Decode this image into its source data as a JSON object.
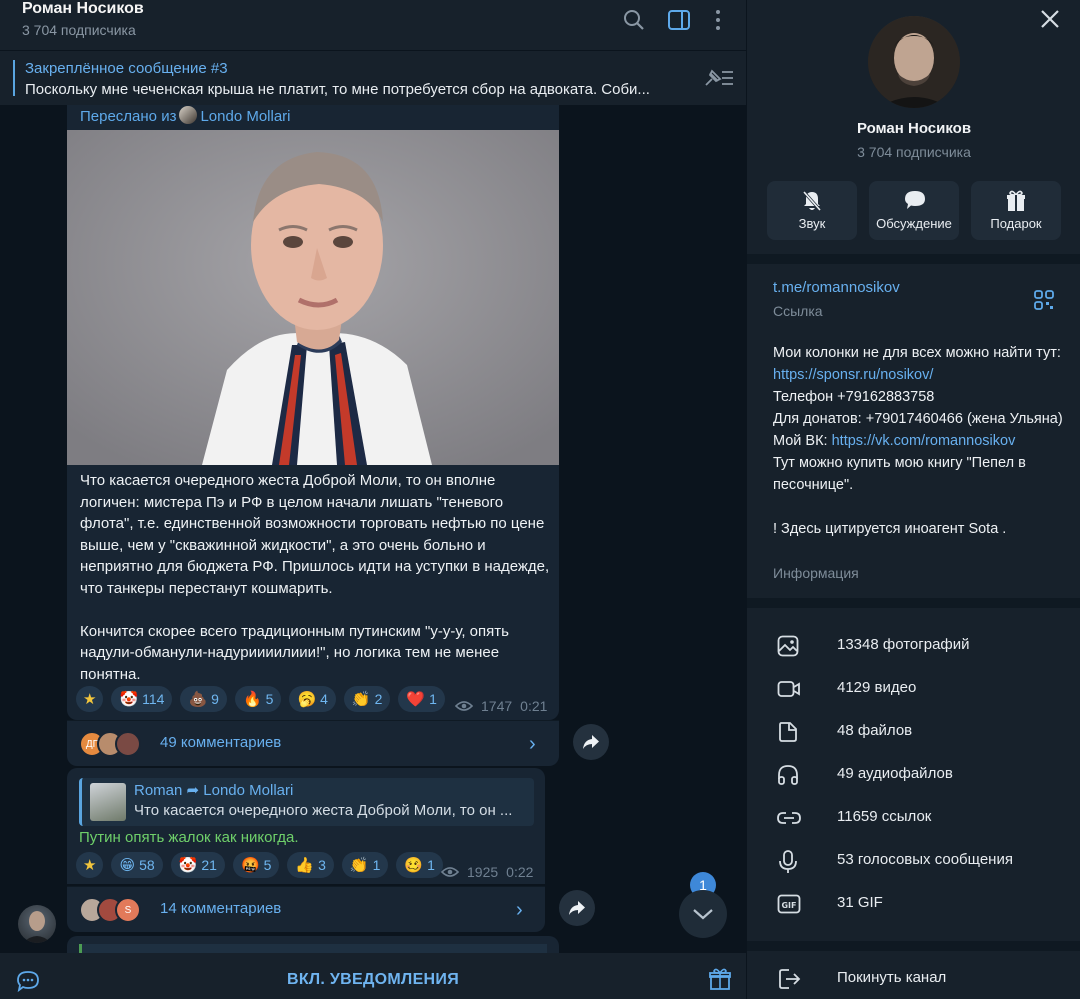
{
  "header": {
    "title": "Роман Носиков",
    "subtitle": "3 704 подписчика"
  },
  "pinned": {
    "title": "Закреплённое сообщение #3",
    "text": "Поскольку мне чеченская крыша не платит, то мне потребуется сбор на адвоката.  Соби..."
  },
  "message1": {
    "forwarded_prefix": "Переслано из",
    "forwarded_from": "Londo Mollari",
    "paragraph1": "Что касается очередного жеста Доброй Моли, то он вполне логичен: мистера Пэ и РФ в целом начали лишать \"теневого флота\", т.е. единственной возможности торговать нефтью по цене выше, чем у \"скважинной жидкости\", а это очень больно и неприятно для бюджета РФ. Пришлось идти на уступки в надежде, что танкеры перестанут кошмарить.",
    "paragraph2": "Кончится скорее всего традиционным путинским \"у-у-у, опять надули-обманули-надуриииилиии!\", но логика тем не менее понятна.",
    "reactions": [
      {
        "emoji": "★",
        "count": ""
      },
      {
        "emoji": "🤡",
        "count": "114"
      },
      {
        "emoji": "💩",
        "count": "9"
      },
      {
        "emoji": "🔥",
        "count": "5"
      },
      {
        "emoji": "🥱",
        "count": "4"
      },
      {
        "emoji": "👏",
        "count": "2"
      },
      {
        "emoji": "❤️",
        "count": "1"
      }
    ],
    "views": "1747",
    "time": "0:21",
    "comments": "49 комментариев",
    "commenter_initials": "ДГ"
  },
  "message2": {
    "reply_from": "Roman",
    "reply_to": "Londo Mollari",
    "reply_text": "Что касается очередного жеста Доброй Моли, то он ...",
    "text": "Путин опять жалок как никогда.",
    "reactions": [
      {
        "emoji": "★",
        "count": ""
      },
      {
        "emoji": "😁",
        "count": "58"
      },
      {
        "emoji": "🤡",
        "count": "21"
      },
      {
        "emoji": "🤬",
        "count": "5"
      },
      {
        "emoji": "👍",
        "count": "3"
      },
      {
        "emoji": "👏",
        "count": "1"
      },
      {
        "emoji": "🥴",
        "count": "1"
      }
    ],
    "views": "1925",
    "time": "0:22",
    "comments": "14 комментариев",
    "commenter_initials": "S"
  },
  "scroll": {
    "unread": "1"
  },
  "bottom": {
    "notify": "ВКЛ. УВЕДОМЛЕНИЯ"
  },
  "panel": {
    "name": "Роман Носиков",
    "subtitle": "3 704 подписчика",
    "buttons": [
      {
        "label": "Звук",
        "icon": "mute-bell-icon"
      },
      {
        "label": "Обсуждение",
        "icon": "chat-bubble-icon"
      },
      {
        "label": "Подарок",
        "icon": "gift-icon"
      }
    ],
    "link": "t.me/romannosikov",
    "link_label": "Ссылка",
    "about": {
      "line1": "Мои колонки не для всех можно найти тут: ",
      "link1": "https://sponsr.ru/nosikov/",
      "phone": "Телефон +79162883758",
      "donate": "Для донатов: +79017460466 (жена Ульяна)",
      "vk_prefix": "Мой ВК: ",
      "vk_link": "https://vk.com/romannosikov",
      "book": "Тут можно купить мою книгу \"Пепел в песочнице\".",
      "notice": "! Здесь цитируется иноагент Sota ."
    },
    "about_label": "Информация",
    "media": [
      {
        "label": "13348 фотографий",
        "icon": "photo-icon"
      },
      {
        "label": "4129 видео",
        "icon": "video-icon"
      },
      {
        "label": "48 файлов",
        "icon": "file-icon"
      },
      {
        "label": "49 аудиофайлов",
        "icon": "headphones-icon"
      },
      {
        "label": "11659 ссылок",
        "icon": "link-icon"
      },
      {
        "label": "53 голосовых сообщения",
        "icon": "microphone-icon"
      },
      {
        "label": "31 GIF",
        "icon": "gif-icon"
      }
    ],
    "leave": "Покинуть канал"
  },
  "colors": {
    "background": "#0e1621",
    "panel": "#17212b",
    "bubble": "#182533",
    "accent": "#68b0ef",
    "green_text": "#6fd06a"
  }
}
